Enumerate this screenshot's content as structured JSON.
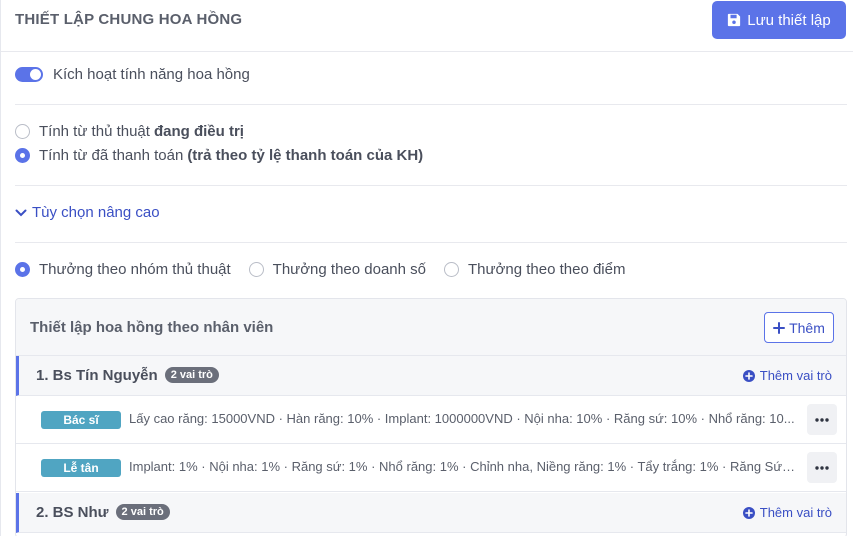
{
  "header": {
    "title": "THIẾT LẬP CHUNG HOA HỒNG",
    "save_label": "Lưu thiết lập"
  },
  "settings": {
    "enable_label": "Kích hoạt tính năng hoa hồng",
    "enable_on": true,
    "calc_options": [
      {
        "prefix": "Tính từ thủ thuật",
        "bold": "đang điều trị",
        "selected": false
      },
      {
        "prefix": "Tính từ đã thanh toán",
        "bold": "(trả theo tỷ lệ thanh toán của KH)",
        "selected": true
      }
    ],
    "advanced_label": "Tùy chọn nâng cao",
    "reward_options": [
      {
        "label": "Thưởng theo nhóm thủ thuật",
        "selected": true
      },
      {
        "label": "Thưởng theo doanh số",
        "selected": false
      },
      {
        "label": "Thưởng theo theo điểm",
        "selected": false
      }
    ]
  },
  "card": {
    "title": "Thiết lập hoa hồng theo nhân viên",
    "add_label": "Thêm",
    "add_role_label": "Thêm vai trò",
    "employees": [
      {
        "name": "1. Bs Tín Nguyễn",
        "role_count": "2 vai trò",
        "roles": [
          {
            "badge": "Bác sĩ",
            "desc": "Lấy cao răng: 15000VND · Hàn răng: 10% · Implant: 1000000VND · Nội nha: 10% · Răng sứ: 10% · Nhổ răng: 10..."
          },
          {
            "badge": "Lễ tân",
            "desc": "Implant: 1% · Nội nha: 1% · Răng sứ: 1% · Nhổ răng: 1% · Chỉnh nha, Niềng răng: 1% · Tẩy trắng: 1% · Răng Sứ: 1..."
          }
        ]
      },
      {
        "name": "2. BS Như",
        "role_count": "2 vai trò",
        "roles": []
      }
    ]
  },
  "colors": {
    "accent": "#5b73e8",
    "link": "#3a4fc4",
    "role_badge": "#50a5c2"
  }
}
